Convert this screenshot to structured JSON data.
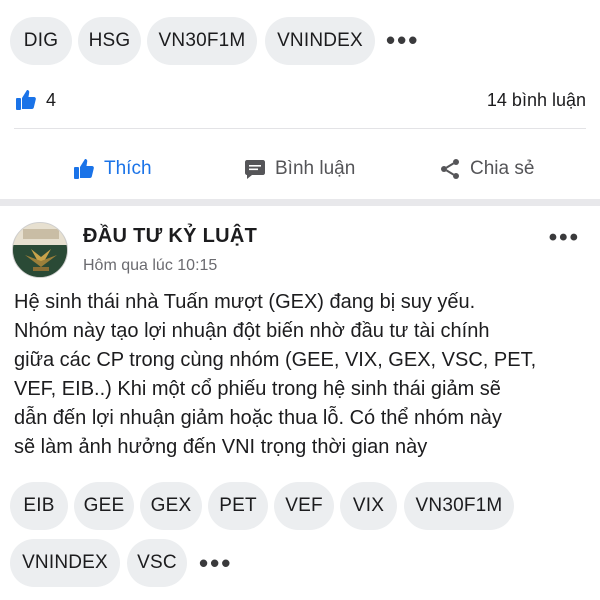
{
  "top_tags": [
    "DIG",
    "HSG",
    "VN30F1M",
    "VNINDEX"
  ],
  "top_tags_more": "•••",
  "stats": {
    "likes": "4",
    "comments": "14 bình luận"
  },
  "actions": {
    "like": "Thích",
    "comment": "Bình luận",
    "share": "Chia sẻ"
  },
  "colors": {
    "accent": "#1a73e8",
    "chip_bg": "#eceef0",
    "divider": "#e3e3e6"
  },
  "post": {
    "author": "ĐẦU TƯ KỶ LUẬT",
    "time": "Hôm qua lúc 10:15",
    "more": "•••",
    "body_lines": [
      "Hệ sinh thái nhà Tuấn mượt (GEX) đang bị suy yếu.",
      "Nhóm này tạo lợi nhuận đột biến nhờ đầu tư tài chính",
      "giữa các CP trong cùng nhóm (GEE, VIX, GEX, VSC, PET,",
      "VEF, EIB..)  Khi một cổ phiếu trong hệ sinh thái giảm sẽ",
      "dẫn đến lợi nhuận giảm hoặc thua lỗ. Có thể nhóm này",
      "sẽ làm ảnh hưởng đến VNI trọng thời gian này"
    ],
    "tags": [
      "EIB",
      "GEE",
      "GEX",
      "PET",
      "VEF",
      "VIX",
      "VN30F1M",
      "VNINDEX",
      "VSC"
    ],
    "tags_more": "•••"
  }
}
